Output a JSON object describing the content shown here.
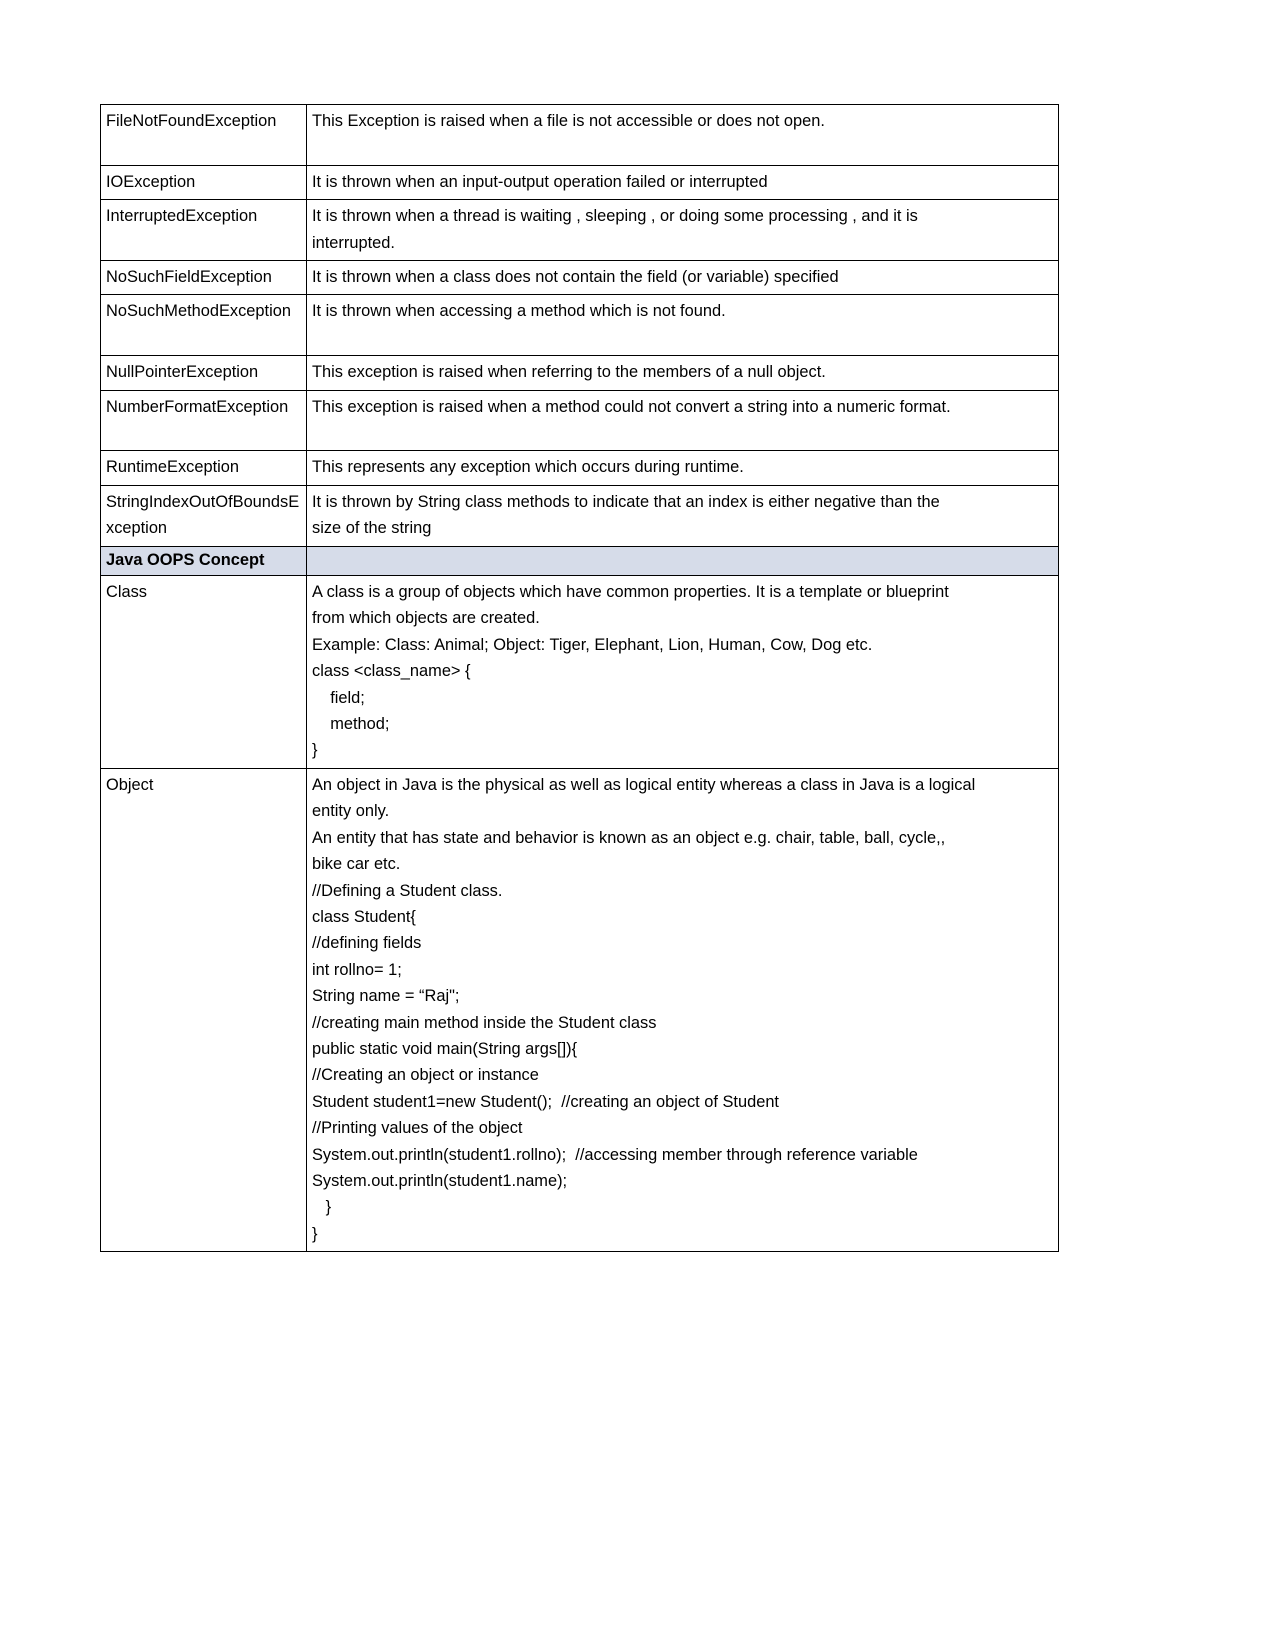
{
  "document": {
    "page_background": "#ffffff",
    "section_header_color": "#d6dce9",
    "border_color": "#000000"
  },
  "table": {
    "rows": [
      {
        "type": "entry",
        "term": "FileNotFoundException",
        "description": [
          "This Exception is raised when a file is not accessible or does not open.",
          ""
        ]
      },
      {
        "type": "entry",
        "term": "IOException",
        "description": [
          "It is thrown when an input-output operation failed or interrupted"
        ]
      },
      {
        "type": "entry",
        "term": "InterruptedException",
        "description": [
          "It is thrown when a thread is waiting , sleeping , or doing some processing , and it is",
          "interrupted."
        ]
      },
      {
        "type": "entry",
        "term": "NoSuchFieldException",
        "description": [
          "It is thrown when a class does not contain the field (or variable) specified"
        ]
      },
      {
        "type": "entry",
        "term": "NoSuchMethodException",
        "description": [
          "It is thrown when accessing a method which is not found.",
          ""
        ]
      },
      {
        "type": "entry",
        "term": "NullPointerException",
        "description": [
          "This exception is raised when referring to the members of a null object."
        ]
      },
      {
        "type": "entry",
        "term": "NumberFormatException",
        "description": [
          "This exception is raised when a method could not convert a string into a numeric format.",
          ""
        ]
      },
      {
        "type": "entry",
        "term": "RuntimeException",
        "description": [
          "This represents any exception which occurs during runtime."
        ]
      },
      {
        "type": "entry",
        "term": "StringIndexOutOfBoundsException",
        "description": [
          "It is thrown by String class methods to indicate that an index is either negative than the",
          "size of the string"
        ]
      },
      {
        "type": "section",
        "term": "Java OOPS Concept",
        "description": [
          ""
        ]
      },
      {
        "type": "entry",
        "term": "Class",
        "description": [
          "A class is a group of objects which have common properties. It is a template or blueprint",
          "from which objects are created.",
          "Example: Class: Animal; Object: Tiger, Elephant, Lion, Human, Cow, Dog etc.",
          "class <class_name> {",
          "    field;",
          "    method;",
          "}"
        ]
      },
      {
        "type": "entry",
        "term": "Object",
        "description": [
          "An object in Java is the physical as well as logical entity whereas a class in Java is a logical",
          "entity only.",
          "An entity that has state and behavior is known as an object e.g. chair, table, ball, cycle,,",
          "bike car etc.",
          "//Defining a Student class.",
          "class Student{",
          "//defining fields",
          "int rollno= 1;",
          "String name = “Raj\";",
          "//creating main method inside the Student class",
          "public static void main(String args[]){",
          "//Creating an object or instance",
          "Student student1=new Student();  //creating an object of Student",
          "//Printing values of the object",
          "System.out.println(student1.rollno);  //accessing member through reference variable",
          "System.out.println(student1.name);",
          "   }",
          "}"
        ]
      }
    ]
  }
}
